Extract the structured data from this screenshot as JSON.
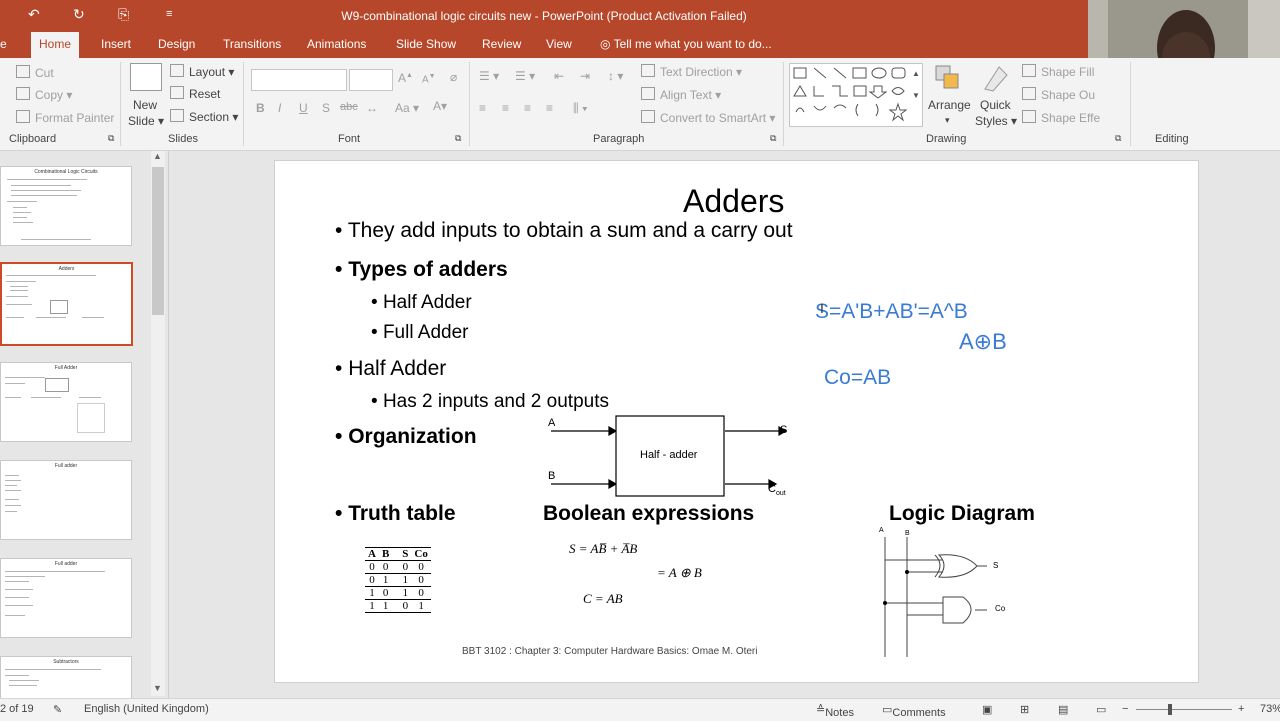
{
  "window": {
    "title": "W9-combinational logic circuits new - PowerPoint (Product Activation Failed)",
    "qa_undo_icon": "undo-icon",
    "qa_redo_icon": "redo-icon",
    "qa_present_icon": "present-icon",
    "qa_customize_icon": "customize-icon"
  },
  "tabs": [
    "Home",
    "Insert",
    "Design",
    "Transitions",
    "Animations",
    "Slide Show",
    "Review",
    "View"
  ],
  "tell_me": "Tell me what you want to do...",
  "ribbon": {
    "clipboard": {
      "cut": "Cut",
      "copy": "Copy",
      "format_painter": "Format Painter",
      "label": "Clipboard"
    },
    "slides": {
      "new_slide": "New",
      "new_slide2": "Slide",
      "layout": "Layout",
      "reset": "Reset",
      "section": "Section",
      "label": "Slides"
    },
    "font": {
      "bold": "B",
      "italic": "I",
      "underline": "U",
      "shadow": "S",
      "strike": "abc",
      "case": "Aa",
      "grow": "A",
      "shrink": "A",
      "label": "Font"
    },
    "paragraph": {
      "text_direction": "Text Direction",
      "align_text": "Align Text",
      "smartart": "Convert to SmartArt",
      "label": "Paragraph"
    },
    "drawing": {
      "arrange": "Arrange",
      "quick_styles": "Quick",
      "quick_styles2": "Styles",
      "shape_fill": "Shape Fill",
      "shape_outline": "Shape Ou",
      "shape_effects": "Shape Effe",
      "label": "Drawing"
    },
    "editing": {
      "label": "Editing"
    }
  },
  "thumbnails": [
    {
      "title": "Combinational Logic Circuits"
    },
    {
      "title": "Adders"
    },
    {
      "title": "Full Adder"
    },
    {
      "title": "Full adder"
    },
    {
      "title": "Full adder"
    },
    {
      "title": "Subtractors"
    }
  ],
  "slide": {
    "title": "Adders",
    "bullets": {
      "b1": "They add inputs to obtain a sum and a carry out",
      "b2": "Types of adders",
      "b2a": "Half Adder",
      "b2b": "Full Adder",
      "b3": "Half Adder",
      "b3a": "Has 2 inputs and 2 outputs",
      "b4": "Organization",
      "b5": "Truth table",
      "boolean_heading": "Boolean expressions",
      "logic_heading": "Logic Diagram"
    },
    "block": {
      "label": "Half - adder",
      "in_a": "A",
      "in_b": "B",
      "out_s": "S",
      "out_c": "C",
      "out_c_sub": "out"
    },
    "truth_table": {
      "headers": [
        "A",
        "B",
        "S",
        "Co"
      ],
      "rows": [
        [
          "0",
          "0",
          "0",
          "0"
        ],
        [
          "0",
          "1",
          "1",
          "0"
        ],
        [
          "1",
          "0",
          "1",
          "0"
        ],
        [
          "1",
          "1",
          "0",
          "1"
        ]
      ]
    },
    "boolean": {
      "s_line": "S = AB̅ + A̅B",
      "xor_line": "= A ⊕ B",
      "c_line": "C = AB"
    },
    "logic_diagram": {
      "a": "A",
      "b": "B",
      "s": "S",
      "c": "Co"
    },
    "ink": {
      "line1": "S=A'B+AB'=A^B",
      "line2": "A⊕B",
      "line3": "Co=AB"
    },
    "footer": "BBT 3102 : Chapter 3: Computer Hardware Basics: Omae M. Oteri"
  },
  "status": {
    "slide_count": "2 of 19",
    "language": "English (United Kingdom)",
    "notes": "Notes",
    "comments": "Comments",
    "zoom": "73%"
  }
}
